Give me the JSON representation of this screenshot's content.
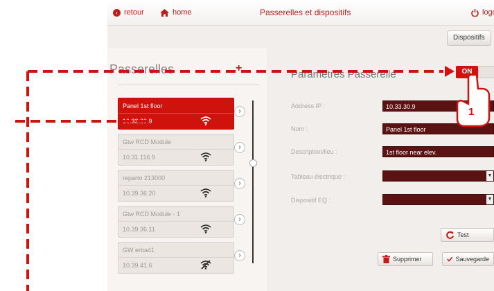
{
  "topbar": {
    "back_label": "retour",
    "home_label": "home",
    "title": "Passerelles et dispositifs",
    "logout_label": "logo"
  },
  "subbar": {
    "devices_button": "Dispositifs"
  },
  "gateways_panel": {
    "title": "Passerelles",
    "items": [
      {
        "name": "Panel 1st floor",
        "ip": "10.33.30.9",
        "selected": true,
        "signal": "wifi-icon"
      },
      {
        "name": "Gtw RCD Module",
        "ip": "10.31.116.9",
        "selected": false,
        "signal": "wifi-icon"
      },
      {
        "name": "reparto 213000",
        "ip": "10.39.36.20",
        "selected": false,
        "signal": "wifi-icon"
      },
      {
        "name": "Gtw RCD Module - 1",
        "ip": "10.39.36.11",
        "selected": false,
        "signal": "wifi-icon"
      },
      {
        "name": "GW erba41",
        "ip": "10.39.41.6",
        "selected": false,
        "signal": "wifi-off-icon"
      }
    ]
  },
  "settings_panel": {
    "title": "Parametres Passerelle",
    "toggle_label": "ON",
    "fields": [
      {
        "label": "Address IP :",
        "value": "10.33.30.9"
      },
      {
        "label": "Nom :",
        "value": "Panel 1st floor"
      },
      {
        "label": "Description/lieu :",
        "value": "1st floor near elev."
      },
      {
        "label": "Tableau électrique :",
        "value": ""
      },
      {
        "label": "Dispositif EQ :",
        "value": ""
      }
    ],
    "test_button": "Test",
    "delete_button": "Supprimer",
    "save_button": "Sauvegarde"
  },
  "annotation": {
    "step_number": "1"
  },
  "colors": {
    "accent": "#d0120d",
    "field_bg": "#5a1212",
    "annotation": "#d0120d"
  }
}
